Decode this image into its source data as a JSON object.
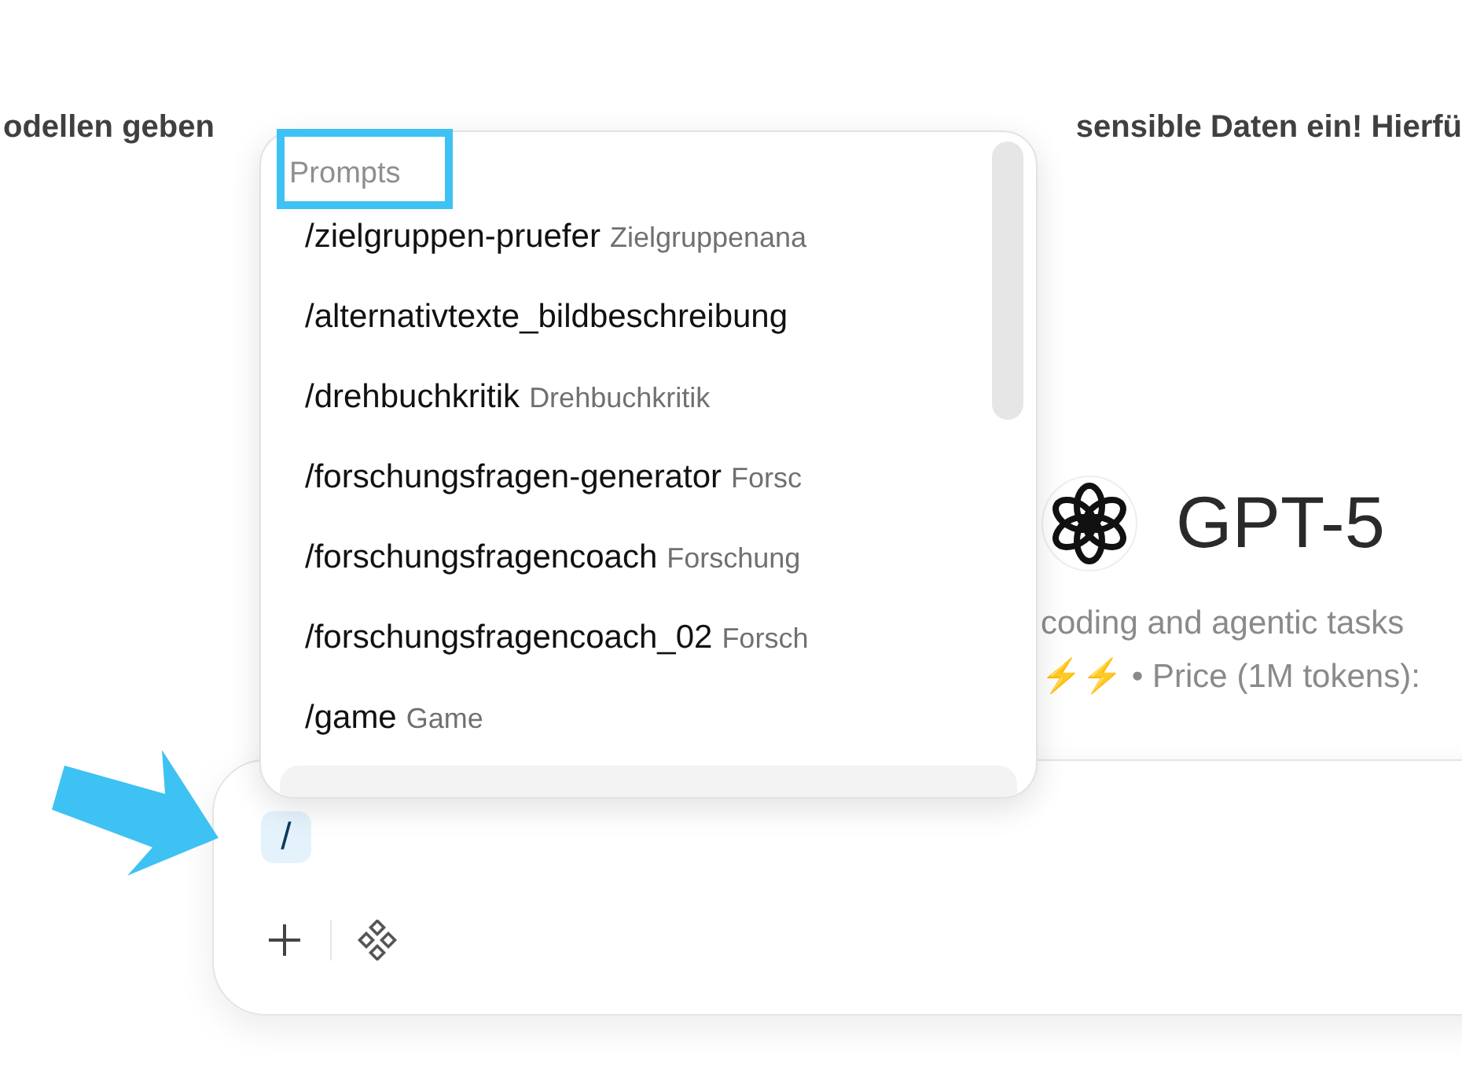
{
  "banner": {
    "left": "odellen geben",
    "right": "sensible Daten ein! Hierfü"
  },
  "model": {
    "name": "GPT-5",
    "description": "coding and agentic tasks",
    "meta": "⚡⚡ • Price (1M tokens):"
  },
  "prompt_menu": {
    "heading": "Prompts",
    "items": [
      {
        "command": "/zielgruppen-pruefer",
        "description": "Zielgruppenana"
      },
      {
        "command": "/alternativtexte_bildbeschreibung"
      },
      {
        "command": "/drehbuchkritik",
        "description": "Drehbuchkritik"
      },
      {
        "command": "/forschungsfragen-generator",
        "description": "Forsc"
      },
      {
        "command": "/forschungsfragencoach",
        "description": "Forschung"
      },
      {
        "command": "/forschungsfragencoach_02",
        "description": "Forsch"
      },
      {
        "command": "/game",
        "description": "Game"
      }
    ]
  },
  "composer": {
    "value": "/"
  }
}
